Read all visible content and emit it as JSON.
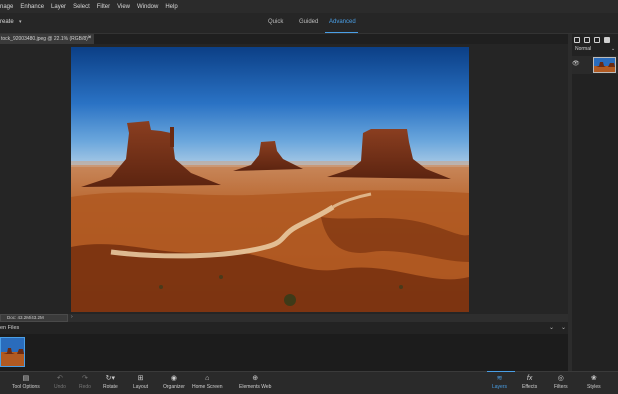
{
  "menu": [
    "nage",
    "Enhance",
    "Layer",
    "Select",
    "Filter",
    "View",
    "Window",
    "Help"
  ],
  "modebar": {
    "create_label": "reate",
    "tabs": [
      "Quick",
      "Guided",
      "Advanced"
    ],
    "active_tab": "Advanced"
  },
  "document": {
    "tab_title": "tock_92003480.jpeg @ 22.1% (RGB/8) *",
    "close_symbol": "×"
  },
  "status": {
    "doc_info": "Doc: 43.2M/43.2M",
    "arrow": "›"
  },
  "bin": {
    "label": "en Files"
  },
  "layers_panel": {
    "blend_mode": "Normal"
  },
  "taskbar": {
    "items": [
      {
        "label": "Tool Options",
        "icon": "tool-options-icon"
      },
      {
        "label": "Undo",
        "icon": "undo-icon"
      },
      {
        "label": "Redo",
        "icon": "redo-icon"
      },
      {
        "label": "Rotate",
        "icon": "rotate-icon"
      },
      {
        "label": "Layout",
        "icon": "layout-icon"
      },
      {
        "label": "Organizer",
        "icon": "organizer-icon"
      },
      {
        "label": "Home Screen",
        "icon": "home-icon"
      },
      {
        "label": "Elements Web",
        "icon": "globe-icon"
      },
      {
        "label": "Layers",
        "icon": "layers-icon"
      },
      {
        "label": "Effects",
        "icon": "fx-icon"
      },
      {
        "label": "Filters",
        "icon": "filters-icon"
      },
      {
        "label": "Styles",
        "icon": "styles-icon"
      }
    ],
    "active": "Layers"
  },
  "colors": {
    "accent": "#4a9fe6",
    "background": "#1e1e1e",
    "panel": "#2a2a2a"
  }
}
